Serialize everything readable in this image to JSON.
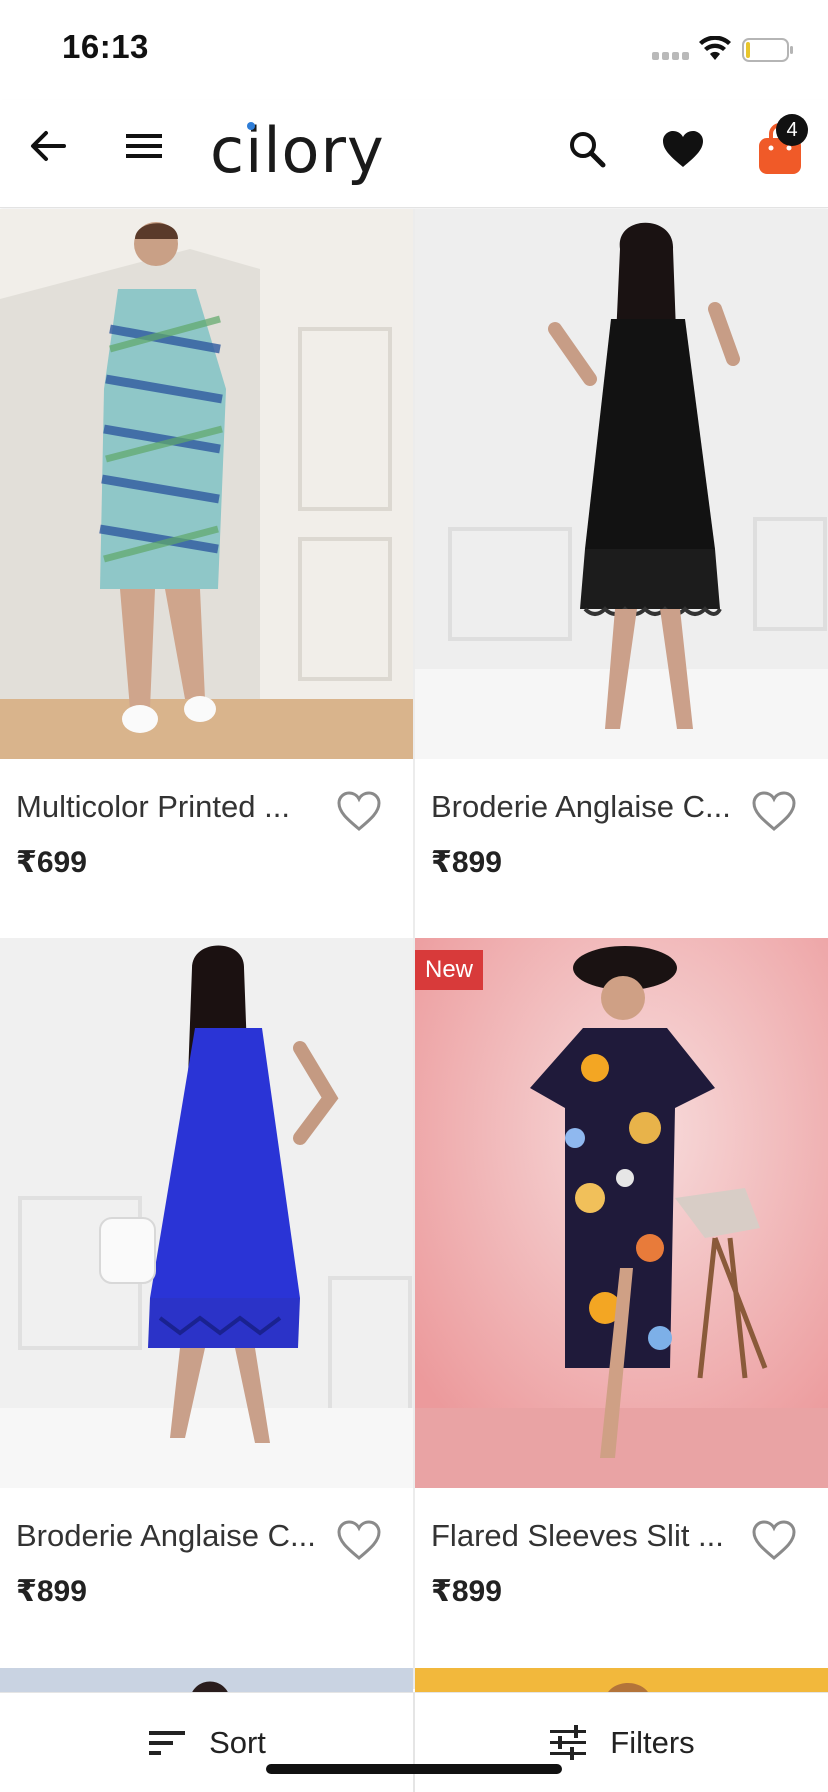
{
  "status_bar": {
    "time": "16:13"
  },
  "header": {
    "logo": "cilory",
    "cart_count": "4",
    "icons": [
      "back-arrow-icon",
      "hamburger-menu-icon",
      "search-icon",
      "heart-filled-icon",
      "shopping-bag-icon"
    ],
    "cart_color": "#f05a28"
  },
  "products": [
    {
      "title": "Multicolor Printed ...",
      "price": "₹699",
      "badge": ""
    },
    {
      "title": "Broderie Anglaise C...",
      "price": "₹899",
      "badge": ""
    },
    {
      "title": "Broderie Anglaise C...",
      "price": "₹899",
      "badge": ""
    },
    {
      "title": "Flared Sleeves Slit ...",
      "price": "₹899",
      "badge": "New"
    }
  ],
  "bottom_bar": {
    "sort_label": "Sort",
    "filters_label": "Filters"
  },
  "colors": {
    "badge_new": "#d83a3a",
    "accent": "#f05a28"
  }
}
